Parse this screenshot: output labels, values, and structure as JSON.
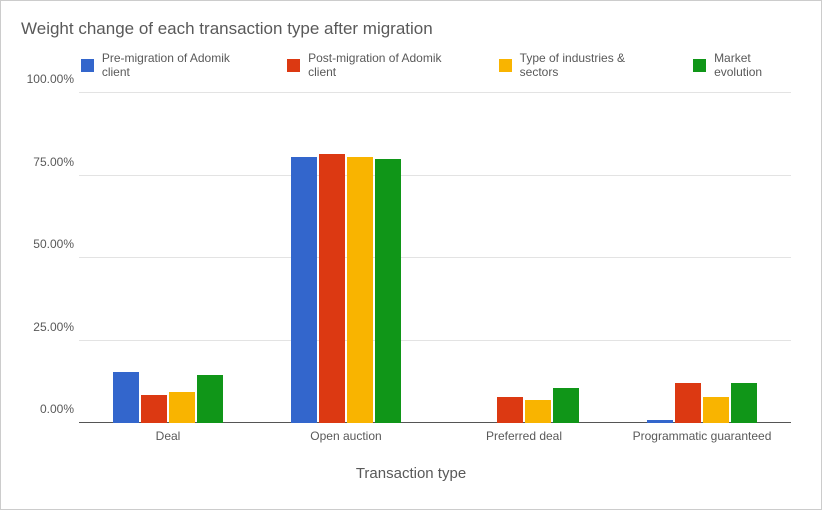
{
  "chart_data": {
    "type": "bar",
    "title": "Weight change of each transaction type after migration",
    "xlabel": "Transaction type",
    "ylabel": "",
    "ylim": [
      0,
      100
    ],
    "y_ticks": [
      "0.00%",
      "25.00%",
      "50.00%",
      "75.00%",
      "100.00%"
    ],
    "categories": [
      "Deal",
      "Open auction",
      "Preferred deal",
      "Programmatic guaranteed"
    ],
    "series": [
      {
        "name": "Pre-migration of Adomik client",
        "color": "#3366cc",
        "values": [
          15.5,
          80.5,
          0.0,
          1.0
        ]
      },
      {
        "name": "Post-migration of Adomik client",
        "color": "#dc3912",
        "values": [
          8.5,
          81.5,
          8.0,
          12.0
        ]
      },
      {
        "name": "Type of industries & sectors",
        "color": "#f9b400",
        "values": [
          9.5,
          80.5,
          7.0,
          8.0
        ]
      },
      {
        "name": "Market evolution",
        "color": "#109618",
        "values": [
          14.5,
          80.0,
          10.5,
          12.0
        ]
      }
    ]
  }
}
